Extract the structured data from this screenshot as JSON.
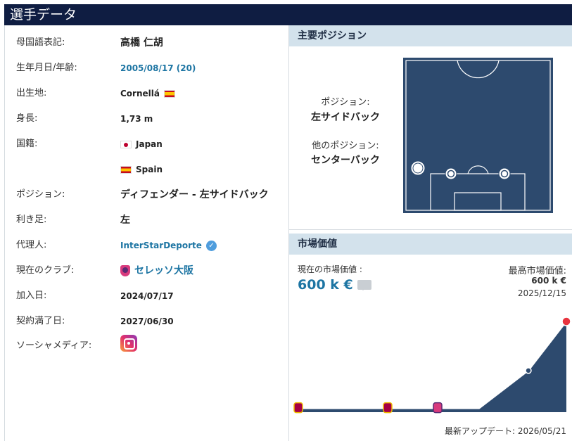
{
  "header": {
    "title": "選手データ"
  },
  "info": {
    "native_name": {
      "label": "母国語表記:",
      "value": "高橋 仁胡"
    },
    "birth": {
      "label": "生年月日/年齢:",
      "value": "2005/08/17 (20)"
    },
    "birthplace": {
      "label": "出生地:",
      "value": "Cornellá",
      "flag": "flag-spain-icon"
    },
    "height": {
      "label": "身長:",
      "value": "1,73 m"
    },
    "citizenship": {
      "label": "国籍:",
      "values": [
        "Japan",
        "Spain"
      ]
    },
    "position": {
      "label": "ポジション:",
      "value": "ディフェンダー - 左サイドバック"
    },
    "foot": {
      "label": "利き足:",
      "value": "左"
    },
    "agent": {
      "label": "代理人:",
      "value": "InterStarDeporte"
    },
    "club": {
      "label": "現在のクラブ:",
      "value": "セレッソ大阪"
    },
    "joined": {
      "label": "加入日:",
      "value": "2024/07/17"
    },
    "contract": {
      "label": "契約満了日:",
      "value": "2027/06/30"
    },
    "social": {
      "label": "ソーシャメディア:",
      "icon": "instagram-icon"
    }
  },
  "main_position": {
    "title": "主要ポジション",
    "position_label": "ポジション:",
    "position_value": "左サイドバック",
    "other_label": "他のポジション:",
    "other_value": "センターバック"
  },
  "market_value": {
    "title": "市場価値",
    "current_label": "現在の市場価値 :",
    "current_value": "600 k €",
    "highest_label": "最高市場価値:",
    "highest_value": "600 k €",
    "highest_date": "2025/12/15",
    "update_label": "最新アップデート: 2026/05/21"
  },
  "chart_data": {
    "type": "area",
    "series": [
      {
        "values": [
          25,
          25,
          25,
          25,
          275,
          600,
          600
        ]
      }
    ],
    "markers": [
      "fc-barcelona",
      "fc-barcelona",
      "cerezo-osaka",
      "",
      "",
      "",
      "cerezo-osaka"
    ],
    "ylim": [
      0,
      600
    ],
    "grid": false,
    "colors": {
      "area": "#2d4a6e",
      "line": "#ffffff"
    }
  }
}
